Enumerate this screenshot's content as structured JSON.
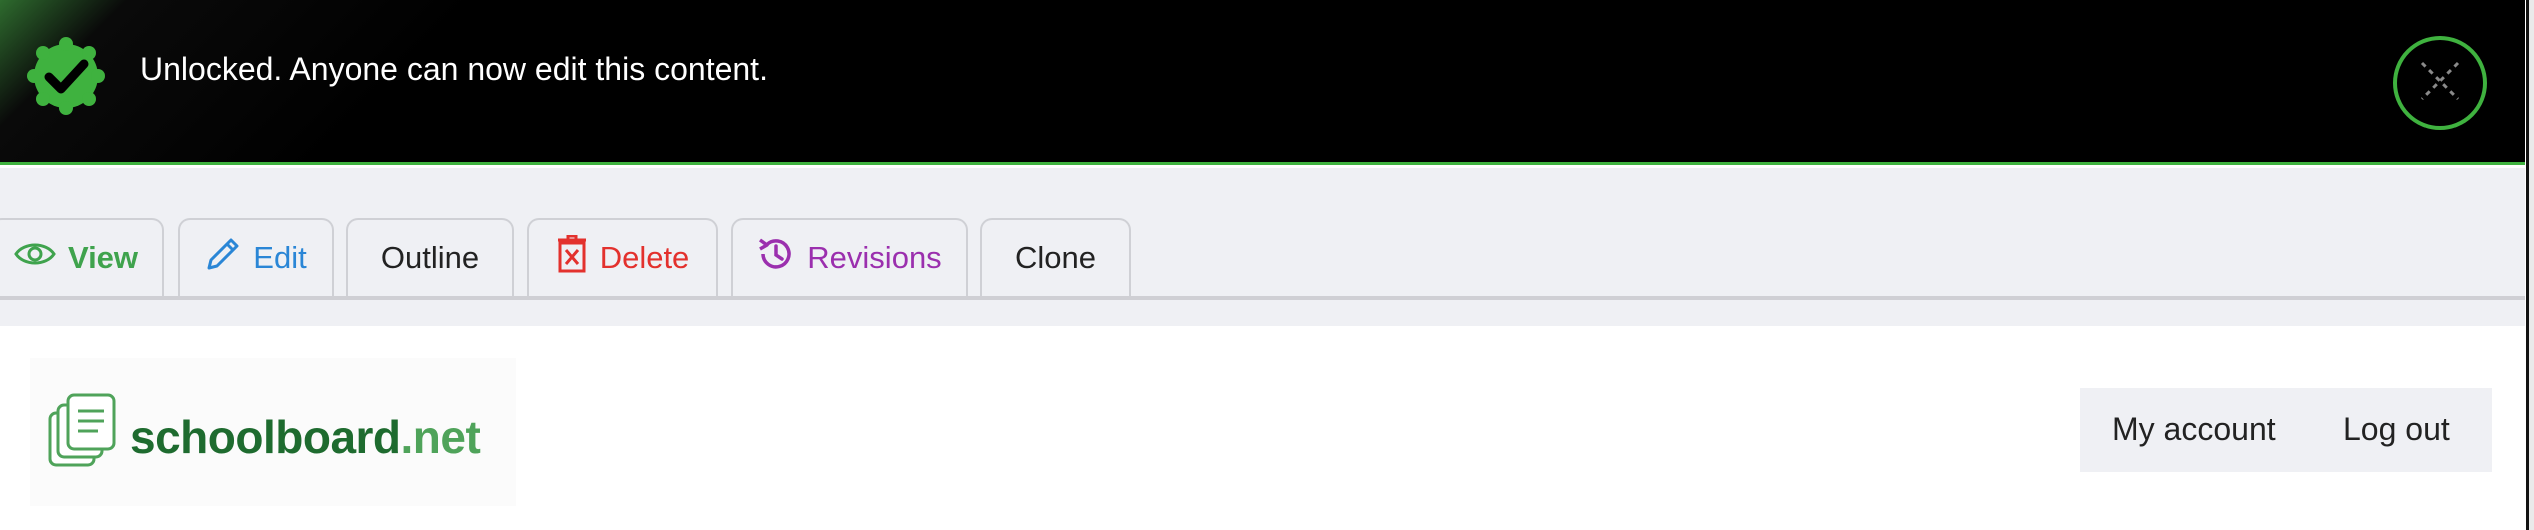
{
  "notification": {
    "message": "Unlocked. Anyone can now edit this content.",
    "icon": "check-badge-icon",
    "close_icon": "close-icon",
    "accent": "#3fb23f"
  },
  "tabs": [
    {
      "label": "View",
      "icon": "eye-icon",
      "color": "#3fa34d",
      "active": true
    },
    {
      "label": "Edit",
      "icon": "pencil-icon",
      "color": "#2a86d6"
    },
    {
      "label": "Outline",
      "icon": "",
      "color": "#222222"
    },
    {
      "label": "Delete",
      "icon": "trash-icon",
      "color": "#e3312d"
    },
    {
      "label": "Revisions",
      "icon": "history-icon",
      "color": "#9b2fae"
    },
    {
      "label": "Clone",
      "icon": "",
      "color": "#222222"
    }
  ],
  "site": {
    "name": "schoolboard",
    "tld": ".net",
    "logo_icon": "documents-icon",
    "brand_dark": "#1e6b2f",
    "brand_light": "#4fa35a"
  },
  "account_menu": {
    "my_account": "My account",
    "log_out": "Log out"
  }
}
